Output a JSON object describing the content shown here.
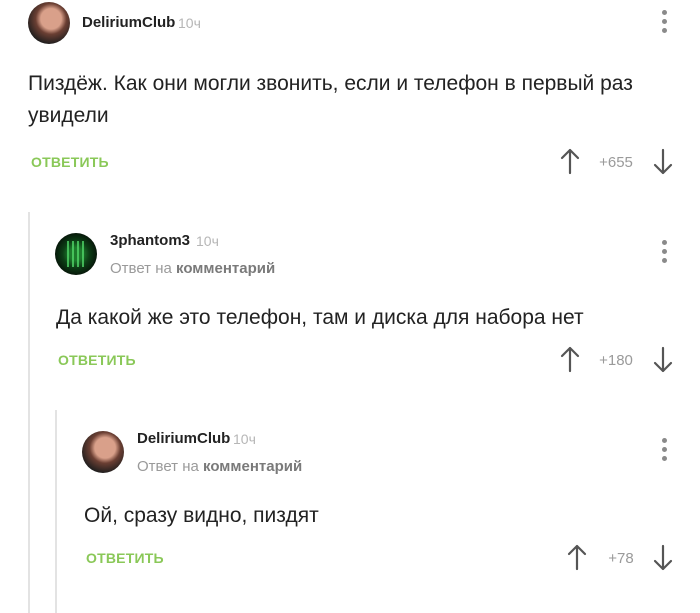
{
  "comments": [
    {
      "username": "DeliriumClub",
      "time": "10ч",
      "text": "Пиздёж. Как они могли звонить, если и телефон в первый раз увидели",
      "reply_label": "ОТВЕТИТЬ",
      "rating": "+655"
    },
    {
      "username": "3phantom3",
      "time": "10ч",
      "reply_to_prefix": "Ответ на",
      "reply_to_target": "комментарий",
      "text": "Да какой же это телефон, там и диска для набора нет",
      "reply_label": "ОТВЕТИТЬ",
      "rating": "+180"
    },
    {
      "username": "DeliriumClub",
      "time": "10ч",
      "reply_to_prefix": "Ответ на",
      "reply_to_target": "комментарий",
      "text": "Ой, сразу видно, пиздят",
      "reply_label": "ОТВЕТИТЬ",
      "rating": "+78"
    }
  ],
  "colors": {
    "accent": "#8ac858",
    "muted": "#9a9a9a",
    "thread_line": "#e3e3e3"
  },
  "icons": [
    "upvote-arrow-icon",
    "downvote-arrow-icon",
    "more-vertical-icon"
  ]
}
